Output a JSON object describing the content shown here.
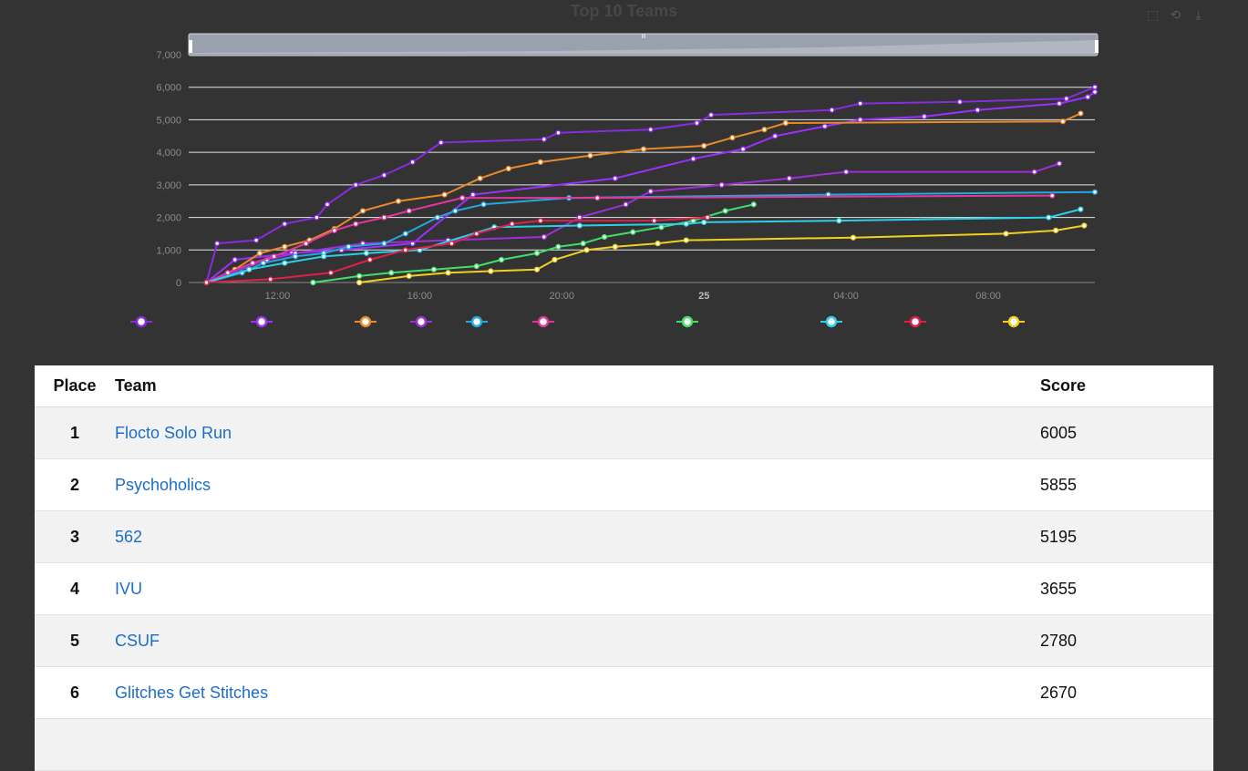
{
  "chart": {
    "title": "Top 10 Teams",
    "toolbox": [
      {
        "name": "zoom-icon",
        "glyph": "⬚"
      },
      {
        "name": "zoom-reset-icon",
        "glyph": "⟲"
      },
      {
        "name": "download-icon",
        "glyph": "⤓"
      }
    ],
    "slider_handle_label": "III"
  },
  "chart_data": {
    "type": "line",
    "title": "Top 10 Teams",
    "xlabel": "",
    "ylabel": "",
    "xlim": [
      9.5,
      11.0
    ],
    "xaxis_note": "hours of day; continues past midnight to 35 = 11:00 next day",
    "x_ticks": [
      {
        "x": 12,
        "label": "12:00"
      },
      {
        "x": 16,
        "label": "16:00"
      },
      {
        "x": 20,
        "label": "20:00"
      },
      {
        "x": 24,
        "label": "25"
      },
      {
        "x": 28,
        "label": "04:00"
      },
      {
        "x": 32,
        "label": "08:00"
      }
    ],
    "ylim": [
      0,
      7000
    ],
    "y_ticks": [
      0,
      1000,
      2000,
      3000,
      4000,
      5000,
      6000,
      7000
    ],
    "y_tick_labels": [
      "0",
      "1,000",
      "2,000",
      "3,000",
      "4,000",
      "5,000",
      "6,000",
      "7,000"
    ],
    "grid": true,
    "legend_position": "bottom",
    "series": [
      {
        "color": "#8a2be2",
        "points": [
          [
            10.0,
            0
          ],
          [
            10.3,
            1200
          ],
          [
            11.4,
            1300
          ],
          [
            12.2,
            1800
          ],
          [
            13.1,
            2000
          ],
          [
            13.4,
            2400
          ],
          [
            14.2,
            3000
          ],
          [
            15.0,
            3300
          ],
          [
            15.8,
            3700
          ],
          [
            16.6,
            4300
          ],
          [
            19.5,
            4400
          ],
          [
            19.9,
            4600
          ],
          [
            22.5,
            4700
          ],
          [
            23.8,
            4900
          ],
          [
            24.2,
            5150
          ],
          [
            27.6,
            5300
          ],
          [
            28.4,
            5500
          ],
          [
            31.2,
            5550
          ],
          [
            34.2,
            5650
          ],
          [
            35.0,
            6005
          ]
        ]
      },
      {
        "color": "#9b30ff",
        "points": [
          [
            10.0,
            0
          ],
          [
            10.8,
            700
          ],
          [
            12.4,
            900
          ],
          [
            13.8,
            1000
          ],
          [
            15.8,
            1200
          ],
          [
            17.5,
            2700
          ],
          [
            21.5,
            3200
          ],
          [
            23.7,
            3800
          ],
          [
            25.1,
            4100
          ],
          [
            26.0,
            4500
          ],
          [
            27.4,
            4800
          ],
          [
            28.4,
            5000
          ],
          [
            30.2,
            5100
          ],
          [
            31.7,
            5300
          ],
          [
            34.0,
            5500
          ],
          [
            34.8,
            5700
          ],
          [
            35.0,
            5855
          ]
        ]
      },
      {
        "color": "#e88a2a",
        "points": [
          [
            10.0,
            0
          ],
          [
            10.8,
            400
          ],
          [
            11.5,
            900
          ],
          [
            12.2,
            1100
          ],
          [
            12.9,
            1300
          ],
          [
            13.6,
            1650
          ],
          [
            14.4,
            2200
          ],
          [
            15.4,
            2500
          ],
          [
            16.7,
            2700
          ],
          [
            17.7,
            3200
          ],
          [
            18.5,
            3500
          ],
          [
            19.4,
            3700
          ],
          [
            20.8,
            3900
          ],
          [
            22.3,
            4100
          ],
          [
            24.0,
            4200
          ],
          [
            24.8,
            4450
          ],
          [
            25.7,
            4700
          ],
          [
            26.3,
            4900
          ],
          [
            34.1,
            4950
          ],
          [
            34.6,
            5195
          ]
        ]
      },
      {
        "color": "#a02fd8",
        "points": [
          [
            10.0,
            0
          ],
          [
            11.7,
            700
          ],
          [
            12.5,
            900
          ],
          [
            14.4,
            1200
          ],
          [
            16.8,
            1300
          ],
          [
            19.5,
            1400
          ],
          [
            20.5,
            2000
          ],
          [
            21.8,
            2400
          ],
          [
            22.5,
            2800
          ],
          [
            24.5,
            3000
          ],
          [
            26.4,
            3200
          ],
          [
            28.0,
            3400
          ],
          [
            33.3,
            3400
          ],
          [
            34.0,
            3655
          ]
        ]
      },
      {
        "color": "#22a8e0",
        "points": [
          [
            10.0,
            0
          ],
          [
            11.0,
            300
          ],
          [
            11.6,
            600
          ],
          [
            12.5,
            800
          ],
          [
            13.3,
            900
          ],
          [
            14.0,
            1100
          ],
          [
            15.0,
            1200
          ],
          [
            15.6,
            1500
          ],
          [
            16.5,
            2000
          ],
          [
            17.0,
            2200
          ],
          [
            17.8,
            2400
          ],
          [
            20.2,
            2600
          ],
          [
            27.5,
            2700
          ],
          [
            35.0,
            2780
          ]
        ]
      },
      {
        "color": "#e0389a",
        "points": [
          [
            10.0,
            0
          ],
          [
            10.6,
            300
          ],
          [
            11.3,
            600
          ],
          [
            11.9,
            800
          ],
          [
            12.8,
            1200
          ],
          [
            13.6,
            1600
          ],
          [
            14.2,
            1800
          ],
          [
            15.0,
            2000
          ],
          [
            15.7,
            2200
          ],
          [
            17.2,
            2600
          ],
          [
            21.0,
            2600
          ],
          [
            33.8,
            2670
          ]
        ]
      },
      {
        "color": "#3ee06a",
        "points": [
          [
            13.0,
            0
          ],
          [
            14.3,
            200
          ],
          [
            15.2,
            300
          ],
          [
            16.4,
            400
          ],
          [
            17.6,
            500
          ],
          [
            18.3,
            700
          ],
          [
            19.3,
            900
          ],
          [
            19.9,
            1100
          ],
          [
            20.6,
            1200
          ],
          [
            21.2,
            1400
          ],
          [
            22.0,
            1550
          ],
          [
            22.8,
            1700
          ],
          [
            23.7,
            1900
          ],
          [
            24.6,
            2200
          ],
          [
            25.4,
            2400
          ]
        ]
      },
      {
        "color": "#2ad0e8",
        "points": [
          [
            10.0,
            0
          ],
          [
            11.2,
            400
          ],
          [
            12.2,
            600
          ],
          [
            13.3,
            800
          ],
          [
            14.5,
            900
          ],
          [
            16.0,
            1000
          ],
          [
            18.1,
            1700
          ],
          [
            20.5,
            1750
          ],
          [
            23.5,
            1800
          ],
          [
            24.0,
            1850
          ],
          [
            27.8,
            1900
          ],
          [
            33.7,
            2000
          ],
          [
            34.6,
            2250
          ]
        ]
      },
      {
        "color": "#e0204a",
        "points": [
          [
            10.0,
            0
          ],
          [
            11.8,
            100
          ],
          [
            13.5,
            300
          ],
          [
            14.6,
            700
          ],
          [
            15.6,
            1000
          ],
          [
            16.9,
            1200
          ],
          [
            17.6,
            1500
          ],
          [
            18.6,
            1800
          ],
          [
            19.4,
            1900
          ],
          [
            22.6,
            1900
          ],
          [
            24.1,
            2000
          ]
        ]
      },
      {
        "color": "#f0d020",
        "points": [
          [
            14.3,
            0
          ],
          [
            15.7,
            200
          ],
          [
            16.8,
            300
          ],
          [
            18.0,
            350
          ],
          [
            19.3,
            400
          ],
          [
            19.8,
            700
          ],
          [
            20.7,
            1000
          ],
          [
            21.5,
            1100
          ],
          [
            22.7,
            1200
          ],
          [
            23.5,
            1300
          ],
          [
            28.2,
            1380
          ],
          [
            32.5,
            1500
          ],
          [
            33.9,
            1600
          ],
          [
            34.7,
            1750
          ]
        ]
      }
    ]
  },
  "legend": [
    {
      "name": "",
      "color": "#8a2be2"
    },
    {
      "name": "",
      "color": "#9b30ff"
    },
    {
      "name": "",
      "color": "#e88a2a"
    },
    {
      "name": "",
      "color": "#a02fd8"
    },
    {
      "name": "",
      "color": "#22a8e0"
    },
    {
      "name": "",
      "color": "#e0389a"
    },
    {
      "name": "",
      "color": "#3ee06a"
    },
    {
      "name": "",
      "color": "#2ad0e8"
    },
    {
      "name": "",
      "color": "#e0204a"
    },
    {
      "name": "",
      "color": "#f0d020"
    }
  ],
  "table": {
    "headers": {
      "place": "Place",
      "team": "Team",
      "score": "Score"
    },
    "rows": [
      {
        "place": "1",
        "team": "Flocto Solo Run",
        "score": "6005"
      },
      {
        "place": "2",
        "team": "Psychoholics",
        "score": "5855"
      },
      {
        "place": "3",
        "team": "562",
        "score": "5195"
      },
      {
        "place": "4",
        "team": "IVU",
        "score": "3655"
      },
      {
        "place": "5",
        "team": "CSUF",
        "score": "2780"
      },
      {
        "place": "6",
        "team": "Glitches Get Stitches",
        "score": "2670"
      }
    ]
  }
}
